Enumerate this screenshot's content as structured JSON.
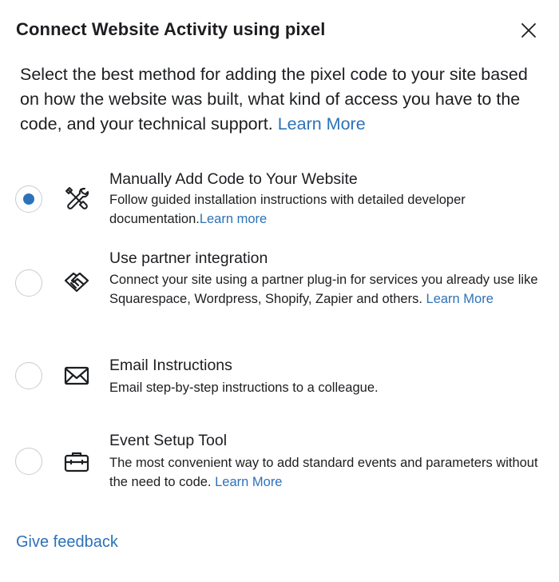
{
  "dialog": {
    "title": "Connect Website Activity using pixel",
    "intro_text": "Select the best method for adding the pixel code to your site based on how the website was built, what kind of access you have to the code, and your technical support.",
    "intro_link": "Learn More"
  },
  "options": [
    {
      "title": "Manually Add Code to Your Website",
      "description": "Follow guided installation instructions with detailed developer documentation.",
      "link": "Learn more",
      "icon": "tools-icon",
      "selected": true
    },
    {
      "title": "Use partner integration",
      "description": "Connect your site using a partner plug-in for services you already use like Squarespace, Wordpress, Shopify, Zapier and others. ",
      "link": "Learn More",
      "icon": "handshake-icon",
      "selected": false
    },
    {
      "title": "Email Instructions",
      "description": "Email step-by-step instructions to a colleague.",
      "link": "",
      "icon": "envelope-icon",
      "selected": false
    },
    {
      "title": "Event Setup Tool",
      "description": "The most convenient way to add standard events and parameters without the need to code. ",
      "link": "Learn More",
      "icon": "toolbox-icon",
      "selected": false
    }
  ],
  "footer": {
    "feedback_label": "Give feedback"
  },
  "colors": {
    "link": "#2d72b8",
    "radio_selected": "#2d72b8",
    "text": "#1c1e21"
  }
}
